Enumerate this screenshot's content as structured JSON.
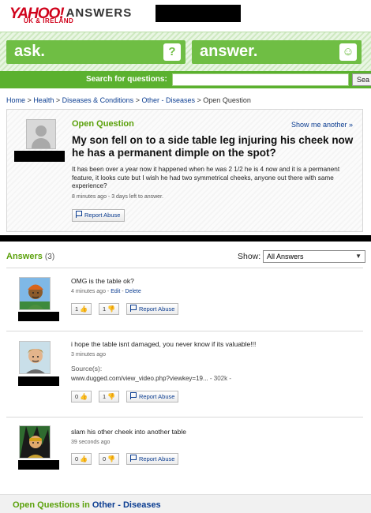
{
  "header": {
    "logo_main": "YAHOO!",
    "logo_product": "ANSWERS",
    "logo_region": "UK & IRELAND"
  },
  "actions": {
    "ask_label": "ask.",
    "ask_icon": "?",
    "answer_label": "answer.",
    "answer_icon": "☺"
  },
  "search": {
    "label": "Search for questions:",
    "placeholder": "",
    "button_label": "Sea"
  },
  "breadcrumb": {
    "items": [
      "Home",
      "Health",
      "Diseases & Conditions",
      "Other - Diseases",
      "Open Question"
    ],
    "separator": ">"
  },
  "question": {
    "status": "Open Question",
    "show_another": "Show me another »",
    "title": "My son fell on to a side table leg injuring his cheek now he has a permanent dimple on the spot?",
    "body": "It has been over a year now it happened when he was 2 1/2 he is 4 now and it is a permanent feature, it looks cute but I wish he had two symmetrical cheeks, anyone out there with same experience?",
    "meta": "8 minutes ago - 3 days left to answer.",
    "report_label": "Report Abuse"
  },
  "answers": {
    "title": "Answers",
    "count": "(3)",
    "show_label": "Show:",
    "show_value": "All Answers",
    "items": [
      {
        "text": "OMG is the table ok?",
        "time": "4 minutes ago",
        "edit": "Edit",
        "delete": "Delete",
        "thumbs_up": "1",
        "thumbs_down": "1",
        "report": "Report Abuse"
      },
      {
        "text": "i hope the table isnt damaged, you never know if its valuable!!!",
        "time": "3 minutes ago",
        "source_label": "Source(s):",
        "source_url": "www.dugged.com/view_video.php?viewkey=19...",
        "source_size": "- 302k -",
        "thumbs_up": "0",
        "thumbs_down": "1",
        "report": "Report Abuse"
      },
      {
        "text": "slam his other cheek into another table",
        "time": "39 seconds ago",
        "thumbs_up": "0",
        "thumbs_down": "0",
        "report": "Report Abuse"
      }
    ]
  },
  "footer": {
    "prefix": "Open Questions in",
    "category": "Other - Diseases"
  },
  "colors": {
    "brand_green": "#6fbe44",
    "link_blue": "#0b3d91",
    "yahoo_red": "#d0021b"
  }
}
